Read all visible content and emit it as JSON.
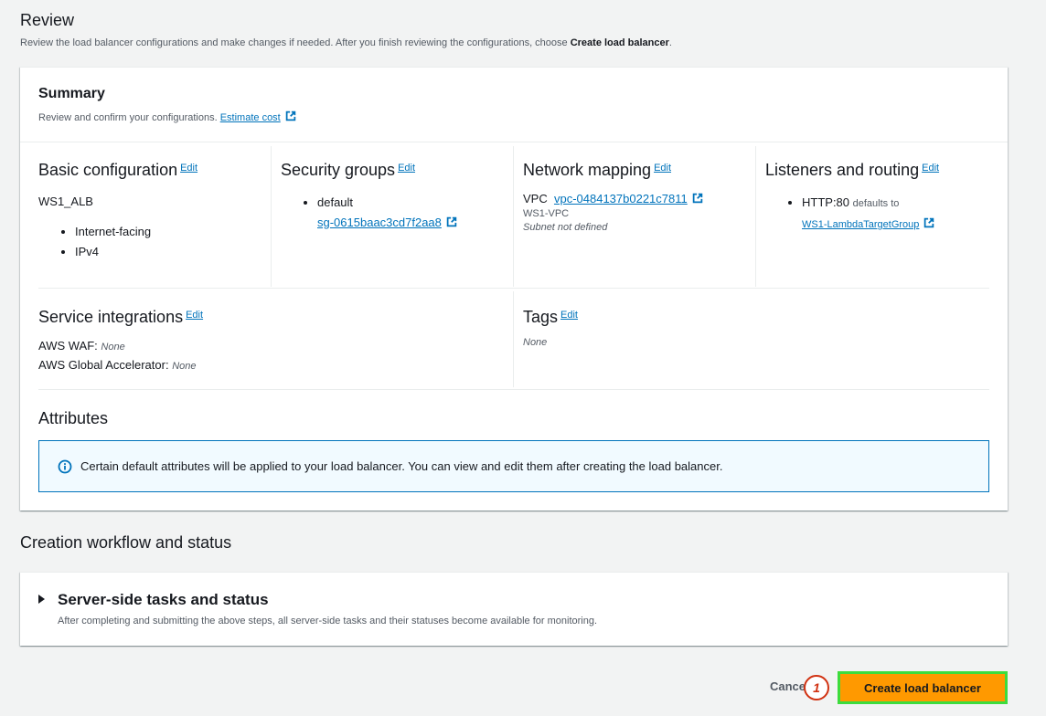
{
  "review": {
    "title": "Review",
    "desc_prefix": "Review the load balancer configurations and make changes if needed. After you finish reviewing the configurations, choose ",
    "desc_bold": "Create load balancer",
    "desc_suffix": "."
  },
  "summary": {
    "title": "Summary",
    "desc": "Review and confirm your configurations.",
    "estimate_cost": "Estimate cost"
  },
  "edit_label": "Edit",
  "basic": {
    "title": "Basic configuration",
    "name": "WS1_ALB",
    "items": [
      "Internet-facing",
      "IPv4"
    ]
  },
  "security": {
    "title": "Security groups",
    "group_name": "default",
    "group_id": "sg-0615baac3cd7f2aa8"
  },
  "network": {
    "title": "Network mapping",
    "vpc_label": "VPC",
    "vpc_id": "vpc-0484137b0221c7811",
    "vpc_name": "WS1-VPC",
    "subnet_note": "Subnet not defined"
  },
  "listeners": {
    "title": "Listeners and routing",
    "protocol": "HTTP:80",
    "defaults_to": "defaults to",
    "target_group": "WS1-LambdaTargetGroup"
  },
  "service": {
    "title": "Service integrations",
    "waf_label": "AWS WAF:",
    "waf_value": "None",
    "ga_label": "AWS Global Accelerator:",
    "ga_value": "None"
  },
  "tags": {
    "title": "Tags",
    "value": "None"
  },
  "attributes": {
    "title": "Attributes",
    "info": "Certain default attributes will be applied to your load balancer. You can view and edit them after creating the load balancer."
  },
  "workflow": {
    "title": "Creation workflow and status",
    "tasks_title": "Server-side tasks and status",
    "tasks_desc": "After completing and submitting the above steps, all server-side tasks and their statuses become available for monitoring."
  },
  "actions": {
    "cancel": "Cancel",
    "create": "Create load balancer",
    "step_badge": "1"
  },
  "colors": {
    "link": "#0073bb",
    "primary_button": "#ff9900",
    "highlight_border": "#3ddc3d",
    "badge": "#d13212"
  }
}
